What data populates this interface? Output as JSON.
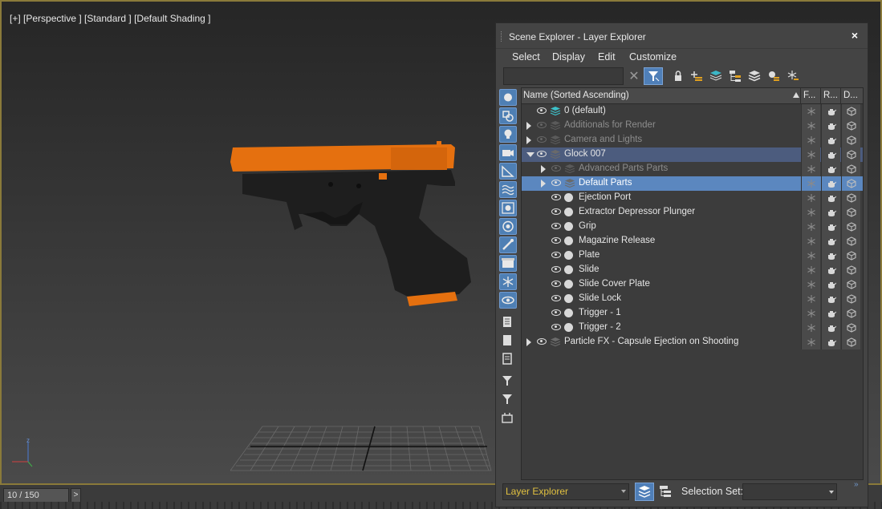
{
  "viewport": {
    "label": "[+] [Perspective ] [Standard ] [Default Shading ]",
    "axis_label": "z"
  },
  "timeline": {
    "frame": "10 / 150",
    "next_label": ">"
  },
  "explorer": {
    "title": "Scene Explorer - Layer Explorer",
    "close_label": "×",
    "menu": [
      "Select",
      "Display",
      "Edit",
      "Customize"
    ],
    "search_placeholder": "",
    "clear_label": "✕",
    "columns": {
      "name": "Name (Sorted Ascending)",
      "col1": "F...",
      "col2": "R...",
      "col3": "D..."
    },
    "rows": [
      {
        "name": "0 (default)",
        "indent": 0,
        "kind": "layer-active",
        "expander": "none",
        "dim": false
      },
      {
        "name": "Additionals for Render",
        "indent": 0,
        "kind": "layer",
        "expander": "closed",
        "dim": true
      },
      {
        "name": "Camera and Lights",
        "indent": 0,
        "kind": "layer",
        "expander": "closed",
        "dim": true
      },
      {
        "name": "Glock 007",
        "indent": 0,
        "kind": "layer",
        "expander": "open",
        "dim": false,
        "state": "parent-sel"
      },
      {
        "name": "Advanced Parts Parts",
        "indent": 1,
        "kind": "layer",
        "expander": "closed",
        "dim": true
      },
      {
        "name": "Default Parts",
        "indent": 1,
        "kind": "layer",
        "expander": "closed",
        "dim": false,
        "state": "selected"
      },
      {
        "name": "Ejection Port",
        "indent": 1,
        "kind": "object",
        "expander": "none",
        "dim": false
      },
      {
        "name": "Extractor Depressor Plunger",
        "indent": 1,
        "kind": "object",
        "expander": "none",
        "dim": false
      },
      {
        "name": "Grip",
        "indent": 1,
        "kind": "object",
        "expander": "none",
        "dim": false
      },
      {
        "name": "Magazine Release",
        "indent": 1,
        "kind": "object",
        "expander": "none",
        "dim": false
      },
      {
        "name": "Plate",
        "indent": 1,
        "kind": "object",
        "expander": "none",
        "dim": false
      },
      {
        "name": "Slide",
        "indent": 1,
        "kind": "object",
        "expander": "none",
        "dim": false
      },
      {
        "name": "Slide Cover Plate",
        "indent": 1,
        "kind": "object",
        "expander": "none",
        "dim": false
      },
      {
        "name": "Slide Lock",
        "indent": 1,
        "kind": "object",
        "expander": "none",
        "dim": false
      },
      {
        "name": "Trigger - 1",
        "indent": 1,
        "kind": "object",
        "expander": "none",
        "dim": false
      },
      {
        "name": "Trigger - 2",
        "indent": 1,
        "kind": "object",
        "expander": "none",
        "dim": false
      },
      {
        "name": "Particle FX - Capsule Ejection on Shooting",
        "indent": 0,
        "kind": "layer",
        "expander": "closed",
        "dim": false
      }
    ],
    "bottom": {
      "mode": "Layer Explorer",
      "selection_set_label": "Selection Set:",
      "selection_set_value": "",
      "more_label": "»"
    },
    "colors": {
      "selection": "#5b87bf",
      "accent_text": "#e0c040",
      "gun_orange": "#e5700f"
    }
  }
}
